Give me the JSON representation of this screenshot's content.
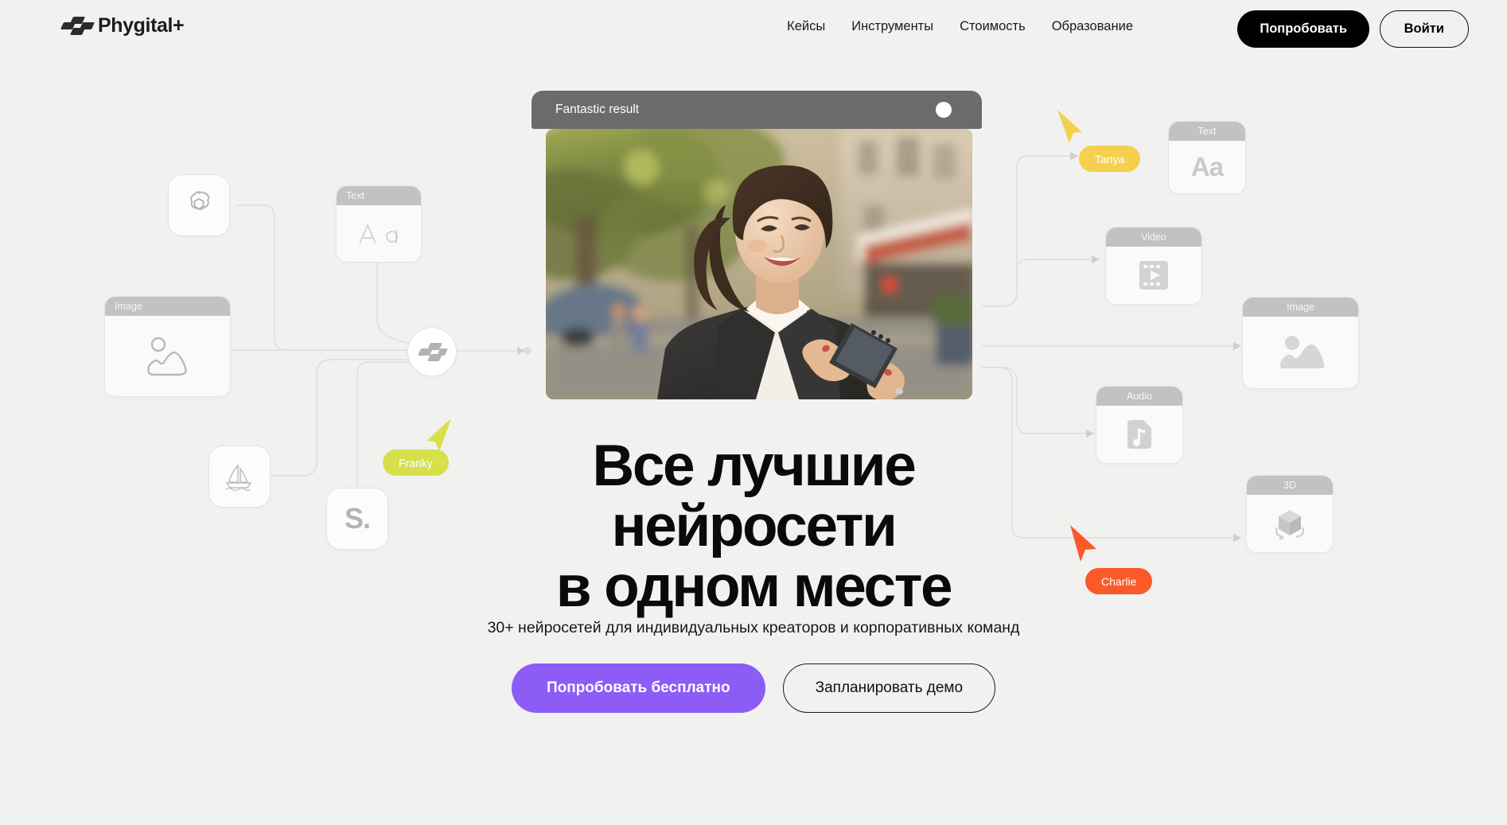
{
  "header": {
    "brand": "Phygital+",
    "logo_icon": "phygital-rhombus-logo",
    "nav": [
      {
        "label": "Кейсы",
        "name": "nav-cases"
      },
      {
        "label": "Инструменты",
        "name": "nav-tools"
      },
      {
        "label": "Стоимость",
        "name": "nav-pricing"
      },
      {
        "label": "Образование",
        "name": "nav-education"
      }
    ],
    "try_button": "Попробовать",
    "login_button": "Войти"
  },
  "hero": {
    "window_title": "Fantastic result",
    "window_dot_icon": "record-dot-icon",
    "image_alt": "smiling-woman-in-suit-with-phone-on-city-street",
    "headline_line1": "Все лучшие",
    "headline_line2": "нейросети",
    "headline_line3": "в одном месте",
    "subtitle": "30+ нейросетей для индивидуальных креаторов и корпоративных команд",
    "cta_primary": "Попробовать бесплатно",
    "cta_secondary": "Запланировать демо"
  },
  "diagram": {
    "center_node_icon": "phygital-logo-icon",
    "tools": [
      {
        "name": "openai-node",
        "icon": "openai-logo-icon"
      },
      {
        "name": "midjourney-node",
        "icon": "midjourney-sailboat-icon"
      },
      {
        "name": "stablediffusion-node",
        "label": "S.",
        "icon": "stability-s-icon"
      }
    ],
    "inputs": [
      {
        "name": "input-card-text",
        "label": "Text",
        "icon": "aa-text-icon",
        "align": "left"
      },
      {
        "name": "input-card-image",
        "label": "Image",
        "icon": "picture-outline-icon",
        "align": "left"
      }
    ],
    "outputs": [
      {
        "name": "output-card-text",
        "label": "Text",
        "icon": "aa-text-icon"
      },
      {
        "name": "output-card-video",
        "label": "Video",
        "icon": "film-play-icon"
      },
      {
        "name": "output-card-image",
        "label": "Image",
        "icon": "picture-filled-icon"
      },
      {
        "name": "output-card-audio",
        "label": "Audio",
        "icon": "music-note-icon"
      },
      {
        "name": "output-card-3d",
        "label": "3D",
        "icon": "rotating-cube-icon"
      }
    ],
    "cursors": [
      {
        "name": "cursor-franky",
        "label": "Franky",
        "color": "#d7e04a"
      },
      {
        "name": "cursor-tanya",
        "label": "Tanya",
        "color": "#f5cf4e"
      },
      {
        "name": "cursor-charlie",
        "label": "Charlie",
        "color": "#fa5a28"
      }
    ]
  },
  "colors": {
    "background": "#f1f1f0",
    "accent_purple": "#8b5cf6",
    "cursor_lime": "#d7e04a",
    "cursor_yellow": "#f5cf4e",
    "cursor_orange": "#fa5a28",
    "window_bar_gray": "#6b6b6b",
    "card_bar_gray": "#c2c2c2"
  }
}
